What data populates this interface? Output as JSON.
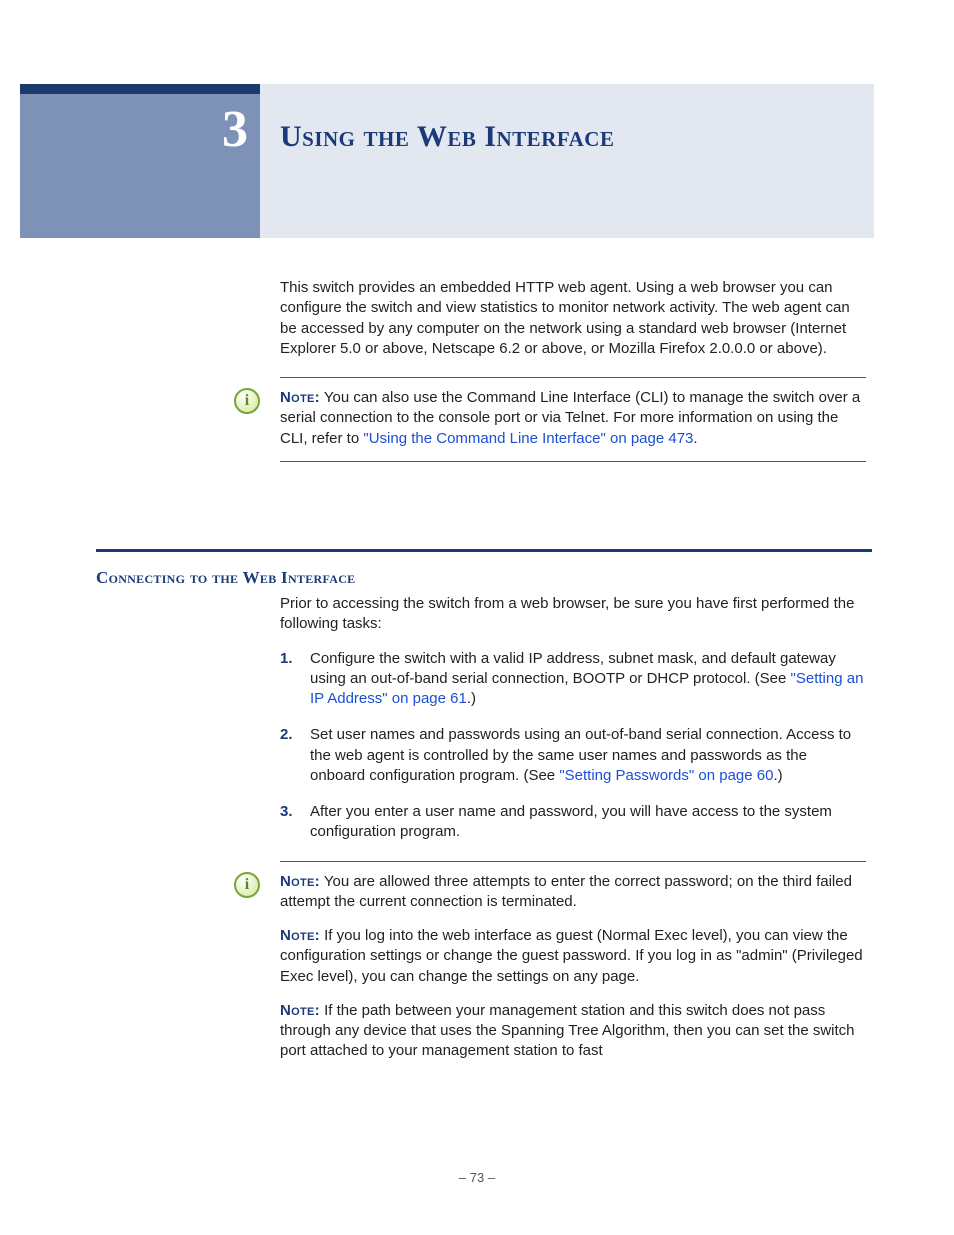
{
  "chapter_number": "3",
  "chapter_title": "Using the Web Interface",
  "intro_paragraph": "This switch provides an embedded HTTP web agent. Using a web browser you can configure the switch and view statistics to monitor network activity. The web agent can be accessed by any computer on the network using a standard web browser (Internet Explorer 5.0 or above, Netscape 6.2 or above, or Mozilla Firefox 2.0.0.0 or above).",
  "note1": {
    "label": "Note:",
    "text_before_link": " You can also use the Command Line Interface (CLI) to manage the switch over a serial connection to the console port or via Telnet. For more information on using the CLI, refer to ",
    "link": "\"Using the Command Line Interface\" on page 473",
    "text_after_link": "."
  },
  "section_heading": "Connecting to the Web Interface",
  "section_intro": "Prior to accessing the switch from a web browser, be sure you have first performed the following tasks:",
  "tasks": [
    {
      "num": "1.",
      "text_a": "Configure the switch with a valid IP address, subnet mask, and default gateway using an out-of-band serial connection, BOOTP or DHCP protocol. (See ",
      "link": "\"Setting an IP Address\" on page 61",
      "text_b": ".)"
    },
    {
      "num": "2.",
      "text_a": "Set user names and passwords using an out-of-band serial connection. Access to the web agent is controlled by the same user names and passwords as the onboard configuration program. (See ",
      "link": "\"Setting Passwords\" on page 60",
      "text_b": ".)"
    },
    {
      "num": "3.",
      "text_a": "After you enter a user name and password, you will have access to the system configuration program.",
      "link": "",
      "text_b": ""
    }
  ],
  "notes_stack": [
    {
      "label": "Note:",
      "text": " You are allowed three attempts to enter the correct password; on the third failed attempt the current connection is terminated."
    },
    {
      "label": "Note:",
      "text": " If you log into the web interface as guest (Normal Exec level), you can view the configuration settings or change the guest password. If you log in as \"admin\" (Privileged Exec level), you can change the settings on any page."
    },
    {
      "label": "Note:",
      "text": " If the path between your management station and this switch does not pass through any device that uses the Spanning Tree Algorithm, then you can set the switch port attached to your management station to fast"
    }
  ],
  "page_number": "–  73  –"
}
